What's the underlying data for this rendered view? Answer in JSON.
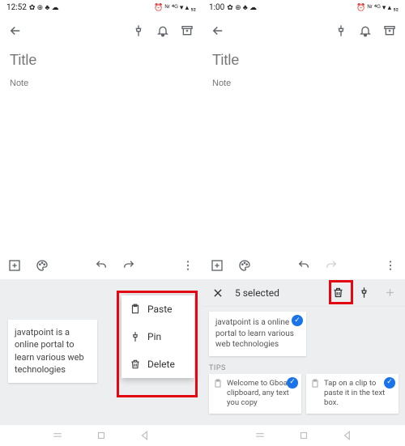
{
  "left": {
    "status": {
      "time": "12:52",
      "icons_left": "✿ ⊕ ♣ ☁",
      "icons_right": "⏰ ᴺʳ ⁴ᴳ ▾ ▴ ₅₂"
    },
    "title_placeholder": "Title",
    "note_placeholder": "Note",
    "clip_text": "javatpoint is a online portal to learn various web technologies",
    "menu": {
      "paste": "Paste",
      "pin": "Pin",
      "delete": "Delete"
    }
  },
  "right": {
    "status": {
      "time": "1:00",
      "icons_left": "✿ ⊕ ♣ ☁",
      "icons_right": "⏰ ᴺʳ ⁴ᴳ ▾ ▴ ₅₂"
    },
    "title_placeholder": "Title",
    "note_placeholder": "Note",
    "selected_text": "5 selected",
    "clip1": "javatpoint is a online portal to learn various web technologies",
    "tips_label": "TIPS",
    "tip1": "Welcome to Gboard clipboard, any text you copy",
    "tip2": "Tap on a clip to paste it in the text box."
  }
}
